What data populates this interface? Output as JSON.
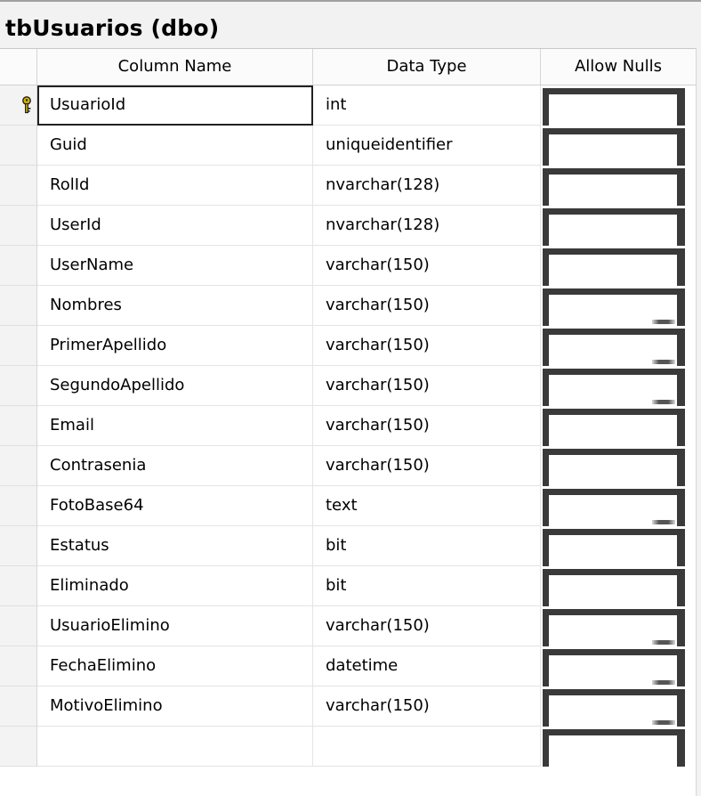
{
  "title": "tbUsuarios (dbo)",
  "headers": {
    "column_name": "Column Name",
    "data_type": "Data Type",
    "allow_nulls": "Allow Nulls"
  },
  "rows": [
    {
      "name": "UsuarioId",
      "type": "int",
      "allow_nulls": false,
      "primary_key": true
    },
    {
      "name": "Guid",
      "type": "uniqueidentifier",
      "allow_nulls": false
    },
    {
      "name": "RolId",
      "type": "nvarchar(128)",
      "allow_nulls": false
    },
    {
      "name": "UserId",
      "type": "nvarchar(128)",
      "allow_nulls": false
    },
    {
      "name": "UserName",
      "type": "varchar(150)",
      "allow_nulls": false
    },
    {
      "name": "Nombres",
      "type": "varchar(150)",
      "allow_nulls": true
    },
    {
      "name": "PrimerApellido",
      "type": "varchar(150)",
      "allow_nulls": true
    },
    {
      "name": "SegundoApellido",
      "type": "varchar(150)",
      "allow_nulls": true
    },
    {
      "name": "Email",
      "type": "varchar(150)",
      "allow_nulls": false
    },
    {
      "name": "Contrasenia",
      "type": "varchar(150)",
      "allow_nulls": false
    },
    {
      "name": "FotoBase64",
      "type": "text",
      "allow_nulls": true
    },
    {
      "name": "Estatus",
      "type": "bit",
      "allow_nulls": false
    },
    {
      "name": "Eliminado",
      "type": "bit",
      "allow_nulls": false
    },
    {
      "name": "UsuarioElimino",
      "type": "varchar(150)",
      "allow_nulls": true
    },
    {
      "name": "FechaElimino",
      "type": "datetime",
      "allow_nulls": true
    },
    {
      "name": "MotivoElimino",
      "type": "varchar(150)",
      "allow_nulls": true
    },
    {
      "name": "",
      "type": "",
      "allow_nulls": false
    }
  ],
  "icons": {
    "primary_key": "key-icon"
  },
  "colors": {
    "key": "#d4b400",
    "checkbox_border": "#3a3a3a"
  }
}
